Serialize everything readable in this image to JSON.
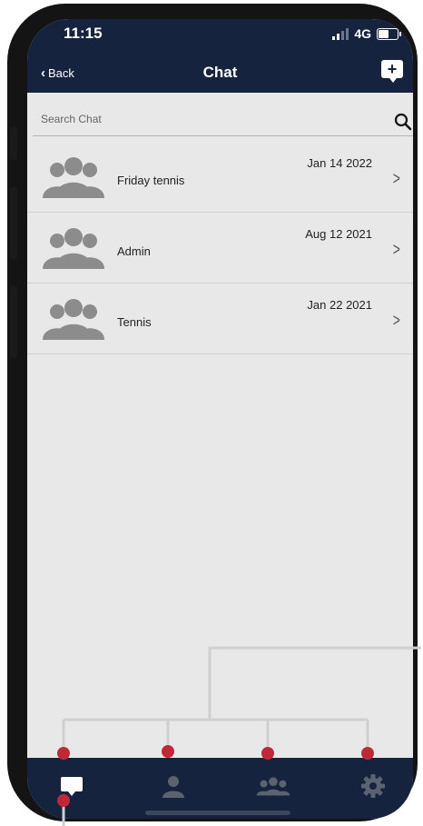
{
  "status_bar": {
    "time": "11:15",
    "network": "4G"
  },
  "header": {
    "back_label": "Back",
    "title": "Chat",
    "new_chat_icon": "add-chat-icon"
  },
  "search": {
    "placeholder": "Search Chat",
    "icon": "search-icon"
  },
  "chats": [
    {
      "name": "Friday tennis",
      "date": "Jan 14 2022",
      "icon": "group-avatar-icon"
    },
    {
      "name": "Admin",
      "date": "Aug 12 2021",
      "icon": "group-avatar-icon"
    },
    {
      "name": "Tennis",
      "date": "Jan 22 2021",
      "icon": "group-avatar-icon"
    }
  ],
  "tab_bar": {
    "tabs": [
      {
        "icon": "chat-icon",
        "active": true
      },
      {
        "icon": "person-icon",
        "active": false
      },
      {
        "icon": "group-icon",
        "active": false
      },
      {
        "icon": "gear-icon",
        "active": false
      }
    ]
  },
  "colors": {
    "navy": "#16233f",
    "background": "#e8e8e8",
    "annotation_dot": "#c0283a",
    "annotation_line": "#cfcfcf",
    "avatar_gray": "#8c8c8c",
    "inactive_icon": "#5b6270"
  }
}
